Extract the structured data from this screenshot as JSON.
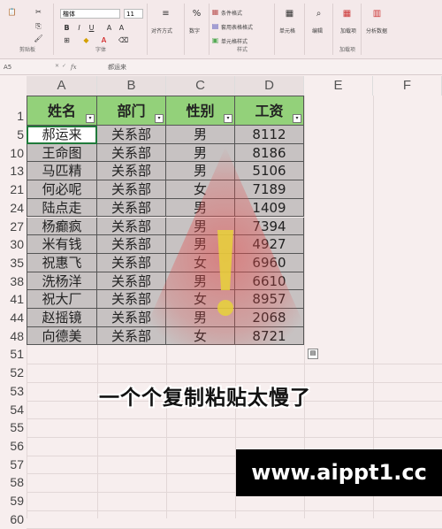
{
  "ribbon": {
    "font_name": "楷体",
    "font_size": "11",
    "font_group_label": "字体",
    "clipboard_label": "剪贴板",
    "align_label": "对齐方式",
    "number_label": "数字",
    "cond_format": "条件格式",
    "table_format": "套用表格格式",
    "cell_style": "单元格样式",
    "style_group_label": "样式",
    "cells_label": "单元格",
    "edit_label": "编辑",
    "addin_label": "加载项",
    "addin_sub": "加载项",
    "analyze_label": "分析数据"
  },
  "formula_bar": {
    "name_box": "A5",
    "fx": "fx",
    "value": "郝运来"
  },
  "columns": [
    "A",
    "B",
    "C",
    "D",
    "E",
    "F"
  ],
  "header_row_num": "1",
  "table": {
    "headers": [
      "姓名",
      "部门",
      "性别",
      "工资"
    ],
    "rows": [
      {
        "row": "5",
        "name": "郝运来",
        "dept": "关系部",
        "sex": "男",
        "salary": "8112"
      },
      {
        "row": "10",
        "name": "王命图",
        "dept": "关系部",
        "sex": "男",
        "salary": "8186"
      },
      {
        "row": "13",
        "name": "马匹精",
        "dept": "关系部",
        "sex": "男",
        "salary": "5106"
      },
      {
        "row": "21",
        "name": "何必呢",
        "dept": "关系部",
        "sex": "女",
        "salary": "7189"
      },
      {
        "row": "24",
        "name": "陆点走",
        "dept": "关系部",
        "sex": "男",
        "salary": "1409"
      },
      {
        "row": "27",
        "name": "杨癫疯",
        "dept": "关系部",
        "sex": "男",
        "salary": "7394"
      },
      {
        "row": "30",
        "name": "米有钱",
        "dept": "关系部",
        "sex": "男",
        "salary": "4927"
      },
      {
        "row": "35",
        "name": "祝惠飞",
        "dept": "关系部",
        "sex": "女",
        "salary": "6960"
      },
      {
        "row": "38",
        "name": "洗杨洋",
        "dept": "关系部",
        "sex": "男",
        "salary": "6610"
      },
      {
        "row": "41",
        "name": "祝大厂",
        "dept": "关系部",
        "sex": "女",
        "salary": "8957"
      },
      {
        "row": "44",
        "name": "赵摇镜",
        "dept": "关系部",
        "sex": "男",
        "salary": "2068"
      },
      {
        "row": "48",
        "name": "向德美",
        "dept": "关系部",
        "sex": "女",
        "salary": "8721"
      }
    ]
  },
  "empty_rows": [
    "51",
    "52",
    "53",
    "54",
    "55",
    "56",
    "57",
    "58",
    "59",
    "60"
  ],
  "caption": "一个个复制粘贴太慢了",
  "watermark": "www.aippt1.cc",
  "colors": {
    "header_fill": "#93d17a",
    "selected_fill": "#c7c2c2",
    "warning": "#d93a3a"
  }
}
